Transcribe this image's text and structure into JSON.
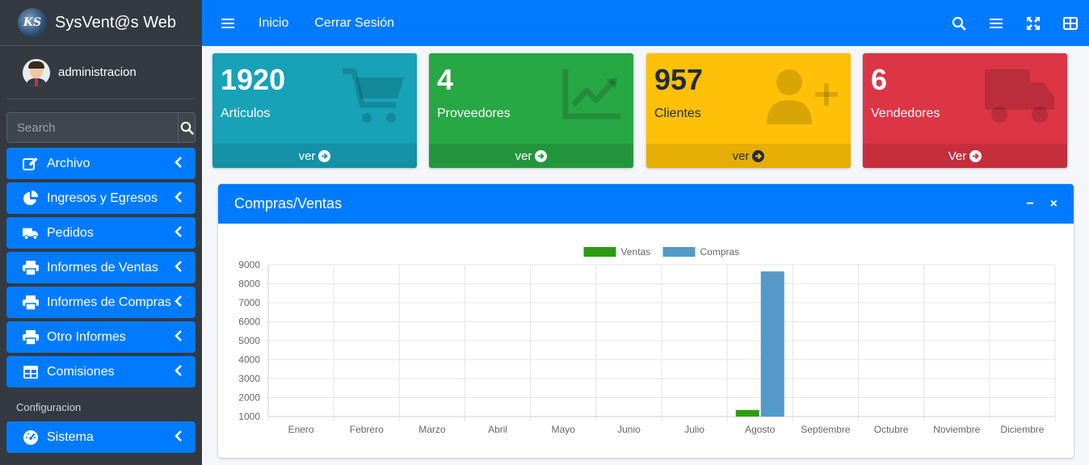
{
  "brand": {
    "logo_text": "KS",
    "name": "SysVent@s Web"
  },
  "user": {
    "name": "administracion"
  },
  "search": {
    "placeholder": "Search"
  },
  "nav": {
    "items": [
      {
        "label": "Archivo",
        "icon": "edit-icon"
      },
      {
        "label": "Ingresos y Egresos",
        "icon": "pie-chart-icon"
      },
      {
        "label": "Pedidos",
        "icon": "truck-icon"
      },
      {
        "label": "Informes de Ventas",
        "icon": "print-icon"
      },
      {
        "label": "Informes de Compras",
        "icon": "print-icon"
      },
      {
        "label": "Otro Informes",
        "icon": "print-icon"
      },
      {
        "label": "Comisiones",
        "icon": "table-icon"
      }
    ],
    "header": "Configuracion",
    "config_items": [
      {
        "label": "Sistema",
        "icon": "tachometer-icon"
      }
    ]
  },
  "topbar": {
    "links": [
      "Inicio",
      "Cerrar Sesión"
    ],
    "right_icons": [
      "search-icon",
      "list-icon",
      "expand-icon",
      "grid-icon"
    ]
  },
  "boxes": [
    {
      "value": "1920",
      "label": "Articulos",
      "footer": "ver",
      "icon": "cart-icon",
      "color": "#17a2b8"
    },
    {
      "value": "4",
      "label": "Proveedores",
      "footer": "ver",
      "icon": "line-chart-icon",
      "color": "#28a745"
    },
    {
      "value": "957",
      "label": "Clientes",
      "footer": "ver",
      "icon": "user-plus-icon",
      "color": "#ffc107"
    },
    {
      "value": "6",
      "label": "Vendedores",
      "footer": "Ver",
      "icon": "truck-icon",
      "color": "#dc3545"
    }
  ],
  "card": {
    "title": "Compras/Ventas",
    "minimize_label": "−",
    "close_label": "×"
  },
  "colors": {
    "primary": "#007bff",
    "sidebar": "#343a40",
    "ventas": "#2d9c12",
    "compras": "#5499c7"
  },
  "chart_data": {
    "type": "bar",
    "categories": [
      "Enero",
      "Febrero",
      "Marzo",
      "Abril",
      "Mayo",
      "Junio",
      "Julio",
      "Agosto",
      "Septiembre",
      "Octubre",
      "Noviembre",
      "Diciembre"
    ],
    "series": [
      {
        "name": "Ventas",
        "color": "#2d9c12",
        "values": [
          0,
          0,
          0,
          0,
          0,
          0,
          0,
          1350,
          0,
          0,
          0,
          0
        ]
      },
      {
        "name": "Compras",
        "color": "#5499c7",
        "values": [
          0,
          0,
          0,
          0,
          0,
          0,
          0,
          8650,
          0,
          0,
          0,
          0
        ]
      }
    ],
    "yticks": [
      1000,
      2000,
      3000,
      4000,
      5000,
      6000,
      7000,
      8000,
      9000
    ],
    "ylim": [
      1000,
      9000
    ],
    "grid": true,
    "legend": "top-center"
  }
}
